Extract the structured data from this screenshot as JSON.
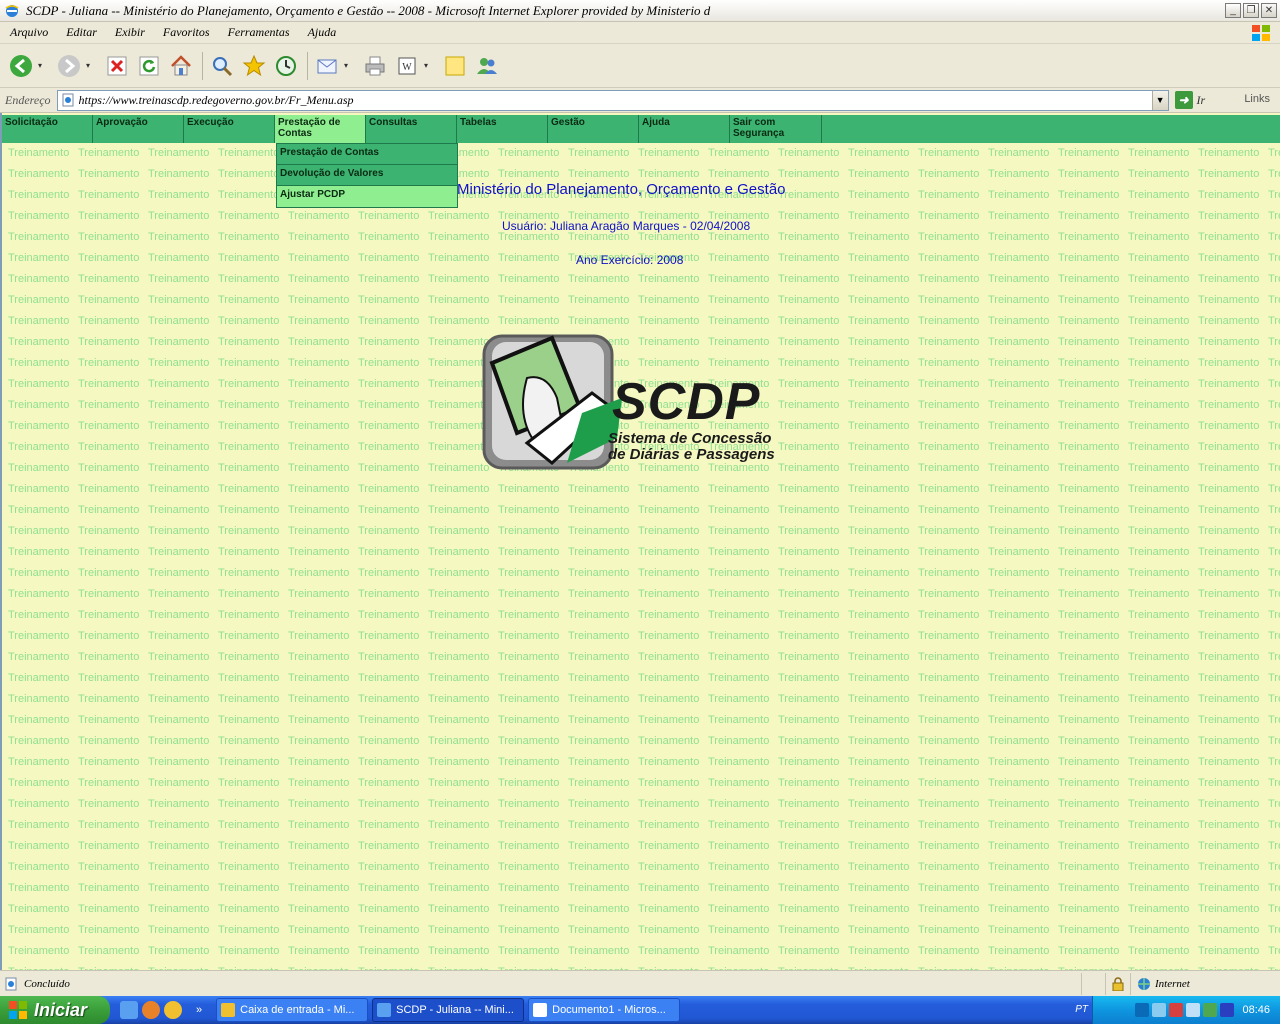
{
  "window": {
    "title": "SCDP - Juliana -- Ministério do Planejamento, Orçamento e Gestão -- 2008 - Microsoft Internet Explorer provided by Ministerio d"
  },
  "menubar": {
    "items": [
      "Arquivo",
      "Editar",
      "Exibir",
      "Favoritos",
      "Ferramentas",
      "Ajuda"
    ]
  },
  "addressbar": {
    "label": "Endereço",
    "url": "https://www.treinascdp.redegoverno.gov.br/Fr_Menu.asp",
    "go_label": "Ir",
    "links_label": "Links"
  },
  "page": {
    "nav": [
      {
        "label": "Solicitação"
      },
      {
        "label": "Aprovação"
      },
      {
        "label": "Execução"
      },
      {
        "label": "Prestação de Contas"
      },
      {
        "label": "Consultas"
      },
      {
        "label": "Tabelas"
      },
      {
        "label": "Gestão"
      },
      {
        "label": "Ajuda"
      },
      {
        "label": "Sair com Segurança"
      }
    ],
    "dropdown": [
      "Prestação de Contas",
      "Devolução de Valores",
      "Ajustar PCDP"
    ],
    "heading": "Ministério do Planejamento, Orçamento e Gestão",
    "user_line": "Usuário:  Juliana Aragão Marques - 02/04/2008",
    "year_line": "Ano Exercício:  2008",
    "watermark_text": "Treinamento",
    "logo": {
      "title": "SCDP",
      "subtitle_line1": "Sistema de Concessão",
      "subtitle_line2": "de Diárias e Passagens"
    }
  },
  "statusbar": {
    "text": "Concluído",
    "zone": "Internet"
  },
  "taskbar": {
    "start_label": "Iniciar",
    "tasks": [
      {
        "label": "Caixa de entrada - Mi..."
      },
      {
        "label": "SCDP - Juliana -- Mini..."
      },
      {
        "label": "Documento1 - Micros..."
      }
    ],
    "language": "PT",
    "clock": "08:46"
  },
  "colors": {
    "nav_bg": "#3CB371",
    "nav_active": "#8FEE8F",
    "page_bg": "#F6F8C2",
    "watermark": "#8FE08F",
    "heading": "#1010C8"
  }
}
